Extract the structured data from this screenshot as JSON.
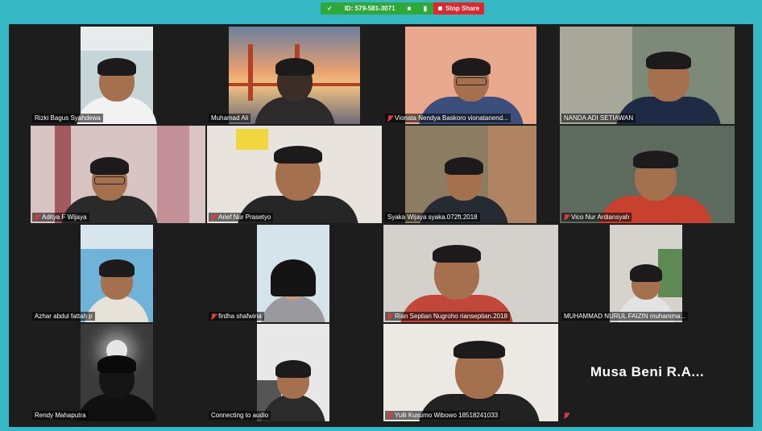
{
  "toolbar": {
    "meeting_id": "ID: 579-581-3071",
    "stop_share": "Stop Share"
  },
  "participants": [
    {
      "name": "Rizki Bagus Syahdewa",
      "muted": false
    },
    {
      "name": "Muhamad Ali",
      "muted": false
    },
    {
      "name": "Vionata Nendya Baskoro vionatanend...",
      "muted": true
    },
    {
      "name": "NANDA ADI SETIAWAN",
      "muted": false
    },
    {
      "name": "Aditya F Wijaya",
      "muted": true
    },
    {
      "name": "Arief Nur Prasetyo",
      "muted": true
    },
    {
      "name": "Syaka Wijaya syaka.072ft.2018",
      "muted": false
    },
    {
      "name": "Vico Nur Ardiansyah",
      "muted": true
    },
    {
      "name": "Azhar abdul fattah p",
      "muted": false
    },
    {
      "name": "firdha shafwina",
      "muted": true
    },
    {
      "name": "Rian Septian Nugroho rianseptian.2018",
      "muted": true
    },
    {
      "name": "MUHAMMAD NURUL FAIZIN muhamma...",
      "muted": false
    },
    {
      "name": "Rendy Mahaputra",
      "muted": false
    },
    {
      "name": "Connecting to audio",
      "muted": false
    },
    {
      "name": "Yulli Kusumo Wibowo 18518241033",
      "muted": true
    },
    {
      "name": "Musa Beni R.A...",
      "muted": true
    }
  ],
  "colors": {
    "background": "#36b8c4",
    "meeting_bar": "#2fa83a",
    "stop_share": "#e2272b",
    "active_speaker": "#c4c94a"
  }
}
